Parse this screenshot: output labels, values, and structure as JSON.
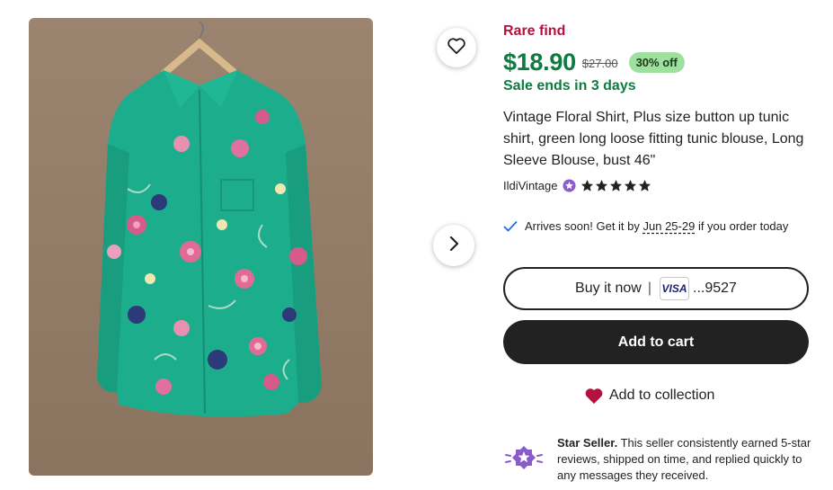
{
  "product": {
    "rare_find": "Rare find",
    "price": "$18.90",
    "original_price": "$27.00",
    "discount": "30% off",
    "sale_ends": "Sale ends in 3 days",
    "title": "Vintage Floral Shirt, Plus size button up tunic shirt, green long loose fitting tunic blouse, Long Sleeve Blouse, bust 46\""
  },
  "seller": {
    "name": "IldiVintage",
    "rating": 5,
    "badge_icon": "star-seller-badge-icon"
  },
  "delivery": {
    "before": "Arrives soon! Get it by ",
    "dates": "Jun 25-29",
    "after": " if you order today"
  },
  "buy_now": {
    "label": "Buy it now",
    "separator": "|",
    "card_brand": "VISA",
    "card_last4": "...9527"
  },
  "add_to_cart": {
    "label": "Add to cart"
  },
  "add_to_collection": {
    "label": "Add to collection"
  },
  "star_seller": {
    "heading": "Star Seller.",
    "text": " This seller consistently earned 5-star reviews, shipped on time, and replied quickly to any messages they received."
  },
  "colors": {
    "rare": "#b3123e",
    "price_green": "#0e7b40",
    "discount_bg": "#9ee09e",
    "button_dark": "#222222",
    "heart_red": "#b3123e",
    "star_seller_purple": "#8a5cc9"
  }
}
